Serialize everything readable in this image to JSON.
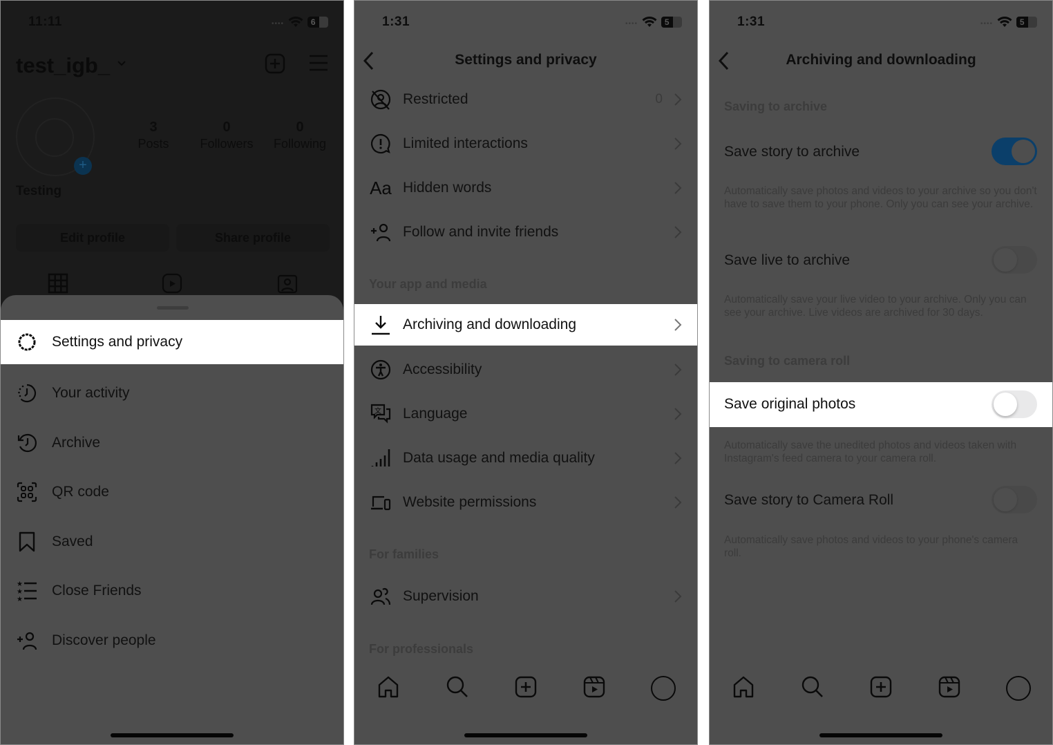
{
  "panel1": {
    "status": {
      "time": "11:11",
      "battery": "6"
    },
    "profile": {
      "username": "test_igb_",
      "display_name": "Testing",
      "stats": [
        {
          "value": "3",
          "label": "Posts"
        },
        {
          "value": "0",
          "label": "Followers"
        },
        {
          "value": "0",
          "label": "Following"
        }
      ],
      "buttons": {
        "edit": "Edit profile",
        "share": "Share profile"
      }
    },
    "menu": [
      {
        "label": "Settings and privacy",
        "icon": "settings-icon",
        "highlighted": true
      },
      {
        "label": "Your activity",
        "icon": "activity-icon"
      },
      {
        "label": "Archive",
        "icon": "archive-icon"
      },
      {
        "label": "QR code",
        "icon": "qr-code-icon"
      },
      {
        "label": "Saved",
        "icon": "bookmark-icon"
      },
      {
        "label": "Close Friends",
        "icon": "close-friends-icon"
      },
      {
        "label": "Discover people",
        "icon": "add-person-icon"
      }
    ]
  },
  "panel2": {
    "status": {
      "time": "1:31",
      "battery": "5"
    },
    "title": "Settings and privacy",
    "rows_top": [
      {
        "label": "Restricted",
        "count": "0",
        "icon": "restricted-icon"
      },
      {
        "label": "Limited interactions",
        "icon": "limited-interactions-icon"
      },
      {
        "label": "Hidden words",
        "icon": "hidden-words-icon"
      },
      {
        "label": "Follow and invite friends",
        "icon": "add-person-icon"
      }
    ],
    "section_app_media": "Your app and media",
    "rows_app_media": [
      {
        "label": "Archiving and downloading",
        "icon": "download-icon",
        "highlighted": true
      },
      {
        "label": "Accessibility",
        "icon": "accessibility-icon"
      },
      {
        "label": "Language",
        "icon": "language-icon"
      },
      {
        "label": "Data usage and media quality",
        "icon": "signal-icon"
      },
      {
        "label": "Website permissions",
        "icon": "devices-icon"
      }
    ],
    "section_families": "For families",
    "rows_families": [
      {
        "label": "Supervision",
        "icon": "supervision-icon"
      }
    ],
    "section_professionals": "For professionals"
  },
  "panel3": {
    "status": {
      "time": "1:31",
      "battery": "5"
    },
    "title": "Archiving and downloading",
    "section_archive": "Saving to archive",
    "section_camera_roll": "Saving to camera roll",
    "settings": [
      {
        "label": "Save story to archive",
        "enabled": true,
        "description": "Automatically save photos and videos to your archive so you don't have to save them to your phone. Only you can see your archive."
      },
      {
        "label": "Save live to archive",
        "enabled": false,
        "description": "Automatically save your live video to your archive. Only you can see your archive. Live videos are archived for 30 days."
      },
      {
        "label": "Save original photos",
        "enabled": false,
        "highlighted": true,
        "description": "Automatically save the unedited photos and videos taken with Instagram's feed camera to your camera roll."
      },
      {
        "label": "Save story to Camera Roll",
        "enabled": false,
        "description": "Automatically save photos and videos to your phone's camera roll."
      }
    ]
  },
  "tabbar": [
    "home-icon",
    "search-icon",
    "create-icon",
    "reels-icon",
    "profile-avatar"
  ],
  "colors": {
    "toggle_on": "#0b3f6a",
    "highlight": "#ffffff",
    "dim_overlay": "#4e4e4e"
  }
}
